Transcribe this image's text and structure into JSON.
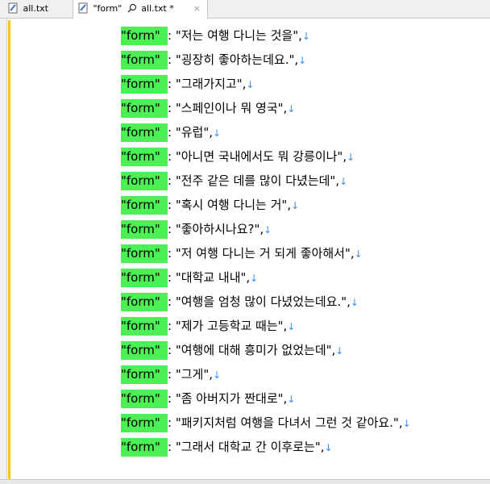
{
  "tabs": [
    {
      "label": "all.txt"
    },
    {
      "label": "\"form\"",
      "label2": "all.txt *",
      "close": "×"
    }
  ],
  "lines": [
    {
      "key": "\"form\"",
      "text": ": \"저는 여행 다니는 것을\","
    },
    {
      "key": "\"form\"",
      "text": ": \"굉장히 좋아하는데요.\","
    },
    {
      "key": "\"form\"",
      "text": ": \"그래가지고\","
    },
    {
      "key": "\"form\"",
      "text": ": \"스페인이나 뭐 영국\","
    },
    {
      "key": "\"form\"",
      "text": ": \"유럽\","
    },
    {
      "key": "\"form\"",
      "text": ": \"아니면 국내에서도 뭐 강릉이나\","
    },
    {
      "key": "\"form\"",
      "text": ": \"전주 같은 데를 많이 다녔는데\","
    },
    {
      "key": "\"form\"",
      "text": ": \"혹시 여행 다니는 거\","
    },
    {
      "key": "\"form\"",
      "text": ": \"좋아하시나요?\","
    },
    {
      "key": "\"form\"",
      "text": ": \"저 여행 다니는 거 되게 좋아해서\","
    },
    {
      "key": "\"form\"",
      "text": ": \"대학교 내내\","
    },
    {
      "key": "\"form\"",
      "text": ": \"여행을 엄청 많이 다녔었는데요.\","
    },
    {
      "key": "\"form\"",
      "text": ": \"제가 고등학교 때는\","
    },
    {
      "key": "\"form\"",
      "text": ": \"여행에 대해 흥미가 없었는데\","
    },
    {
      "key": "\"form\"",
      "text": ": \"그게\","
    },
    {
      "key": "\"form\"",
      "text": ": \"좀 아버지가 짠대로\","
    },
    {
      "key": "\"form\"",
      "text": ": \"패키지처럼 여행을 다녀서 그런 것 같아요.\","
    },
    {
      "key": "\"form\"",
      "text": ": \"그래서 대학교 간 이후로는\","
    }
  ],
  "eol_glyph": "↓",
  "colors": {
    "highlight": "#4cf054",
    "eol": "#3a8ee6",
    "change_marker": "#f2c811"
  }
}
